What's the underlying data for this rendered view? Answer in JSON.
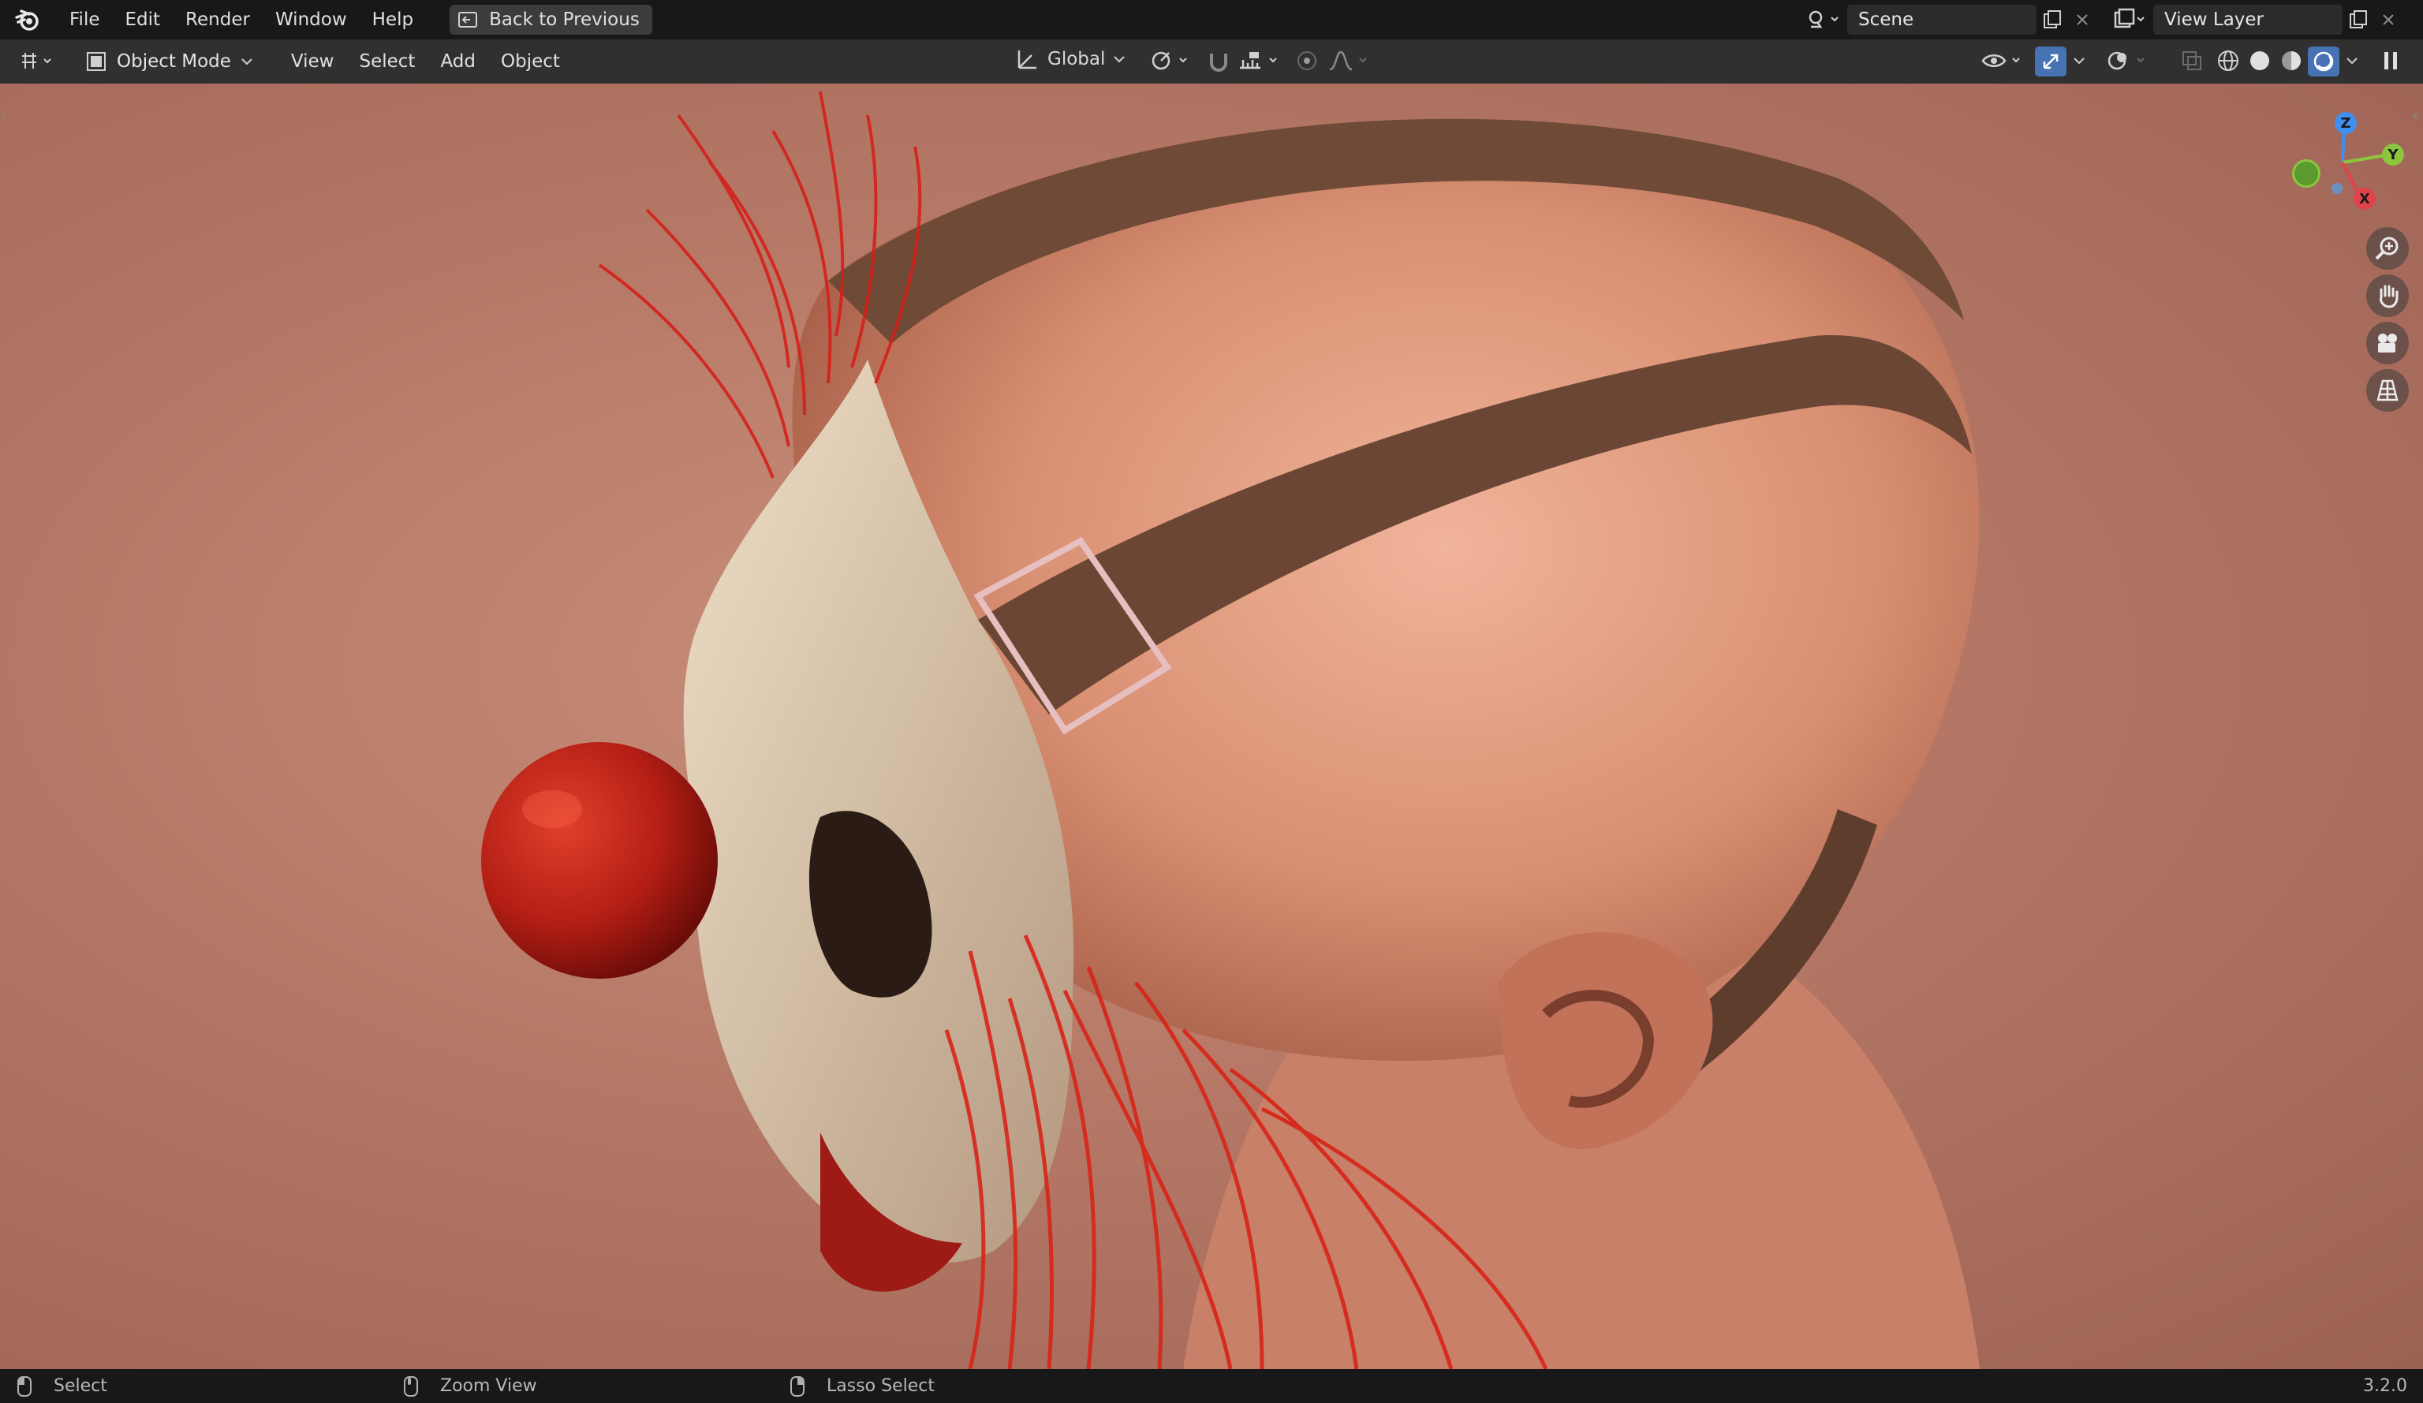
{
  "topbar": {
    "menus": [
      "File",
      "Edit",
      "Render",
      "Window",
      "Help"
    ],
    "back_button": "Back to Previous",
    "scene": "Scene",
    "view_layer": "View Layer"
  },
  "header": {
    "mode": "Object Mode",
    "menus": [
      "View",
      "Select",
      "Add",
      "Object"
    ],
    "transform_orientation": "Global"
  },
  "gizmo": {
    "z": "Z",
    "y": "Y",
    "x": "X"
  },
  "statusbar": {
    "left_click": "Select",
    "middle_click": "Zoom View",
    "right_click": "Lasso Select",
    "version": "3.2.0"
  },
  "colors": {
    "axis_x": "#e0434a",
    "axis_y": "#8bc63e",
    "axis_z": "#3f8ff0",
    "accent": "#4772b3"
  },
  "viewport": {
    "render_subject": "3D clown mask head with red hair and red nose"
  }
}
